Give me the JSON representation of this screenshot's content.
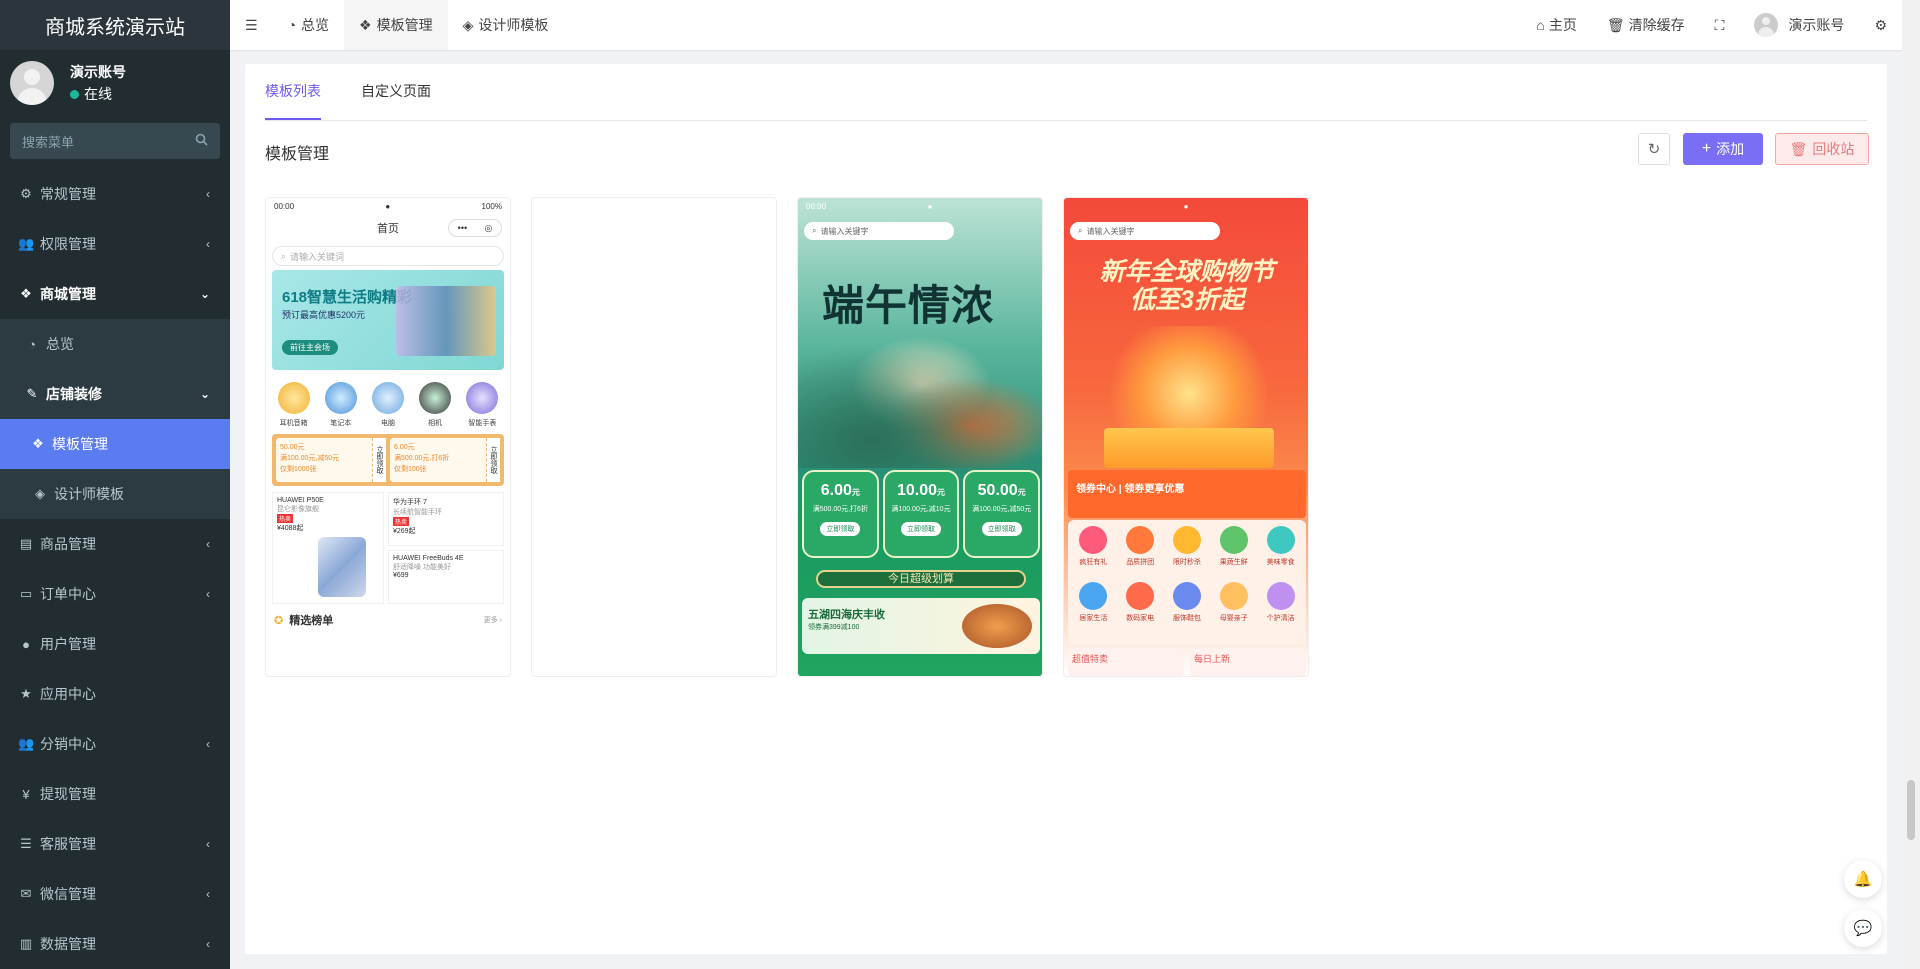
{
  "app": {
    "title": "商城系统演示站"
  },
  "user": {
    "name": "演示账号",
    "status": "在线"
  },
  "sidebar": {
    "search_placeholder": "搜索菜单",
    "items": [
      {
        "label": "常规管理"
      },
      {
        "label": "权限管理"
      },
      {
        "label": "商城管理"
      },
      {
        "label": "总览"
      },
      {
        "label": "店铺装修"
      },
      {
        "label": "模板管理"
      },
      {
        "label": "设计师模板"
      },
      {
        "label": "商品管理"
      },
      {
        "label": "订单中心"
      },
      {
        "label": "用户管理"
      },
      {
        "label": "应用中心"
      },
      {
        "label": "分销中心"
      },
      {
        "label": "提现管理"
      },
      {
        "label": "客服管理"
      },
      {
        "label": "微信管理"
      },
      {
        "label": "数据管理"
      }
    ]
  },
  "topbar": {
    "tabs": [
      {
        "label": "总览"
      },
      {
        "label": "模板管理"
      },
      {
        "label": "设计师模板"
      }
    ],
    "home": "主页",
    "clear_cache": "清除缓存",
    "account": "演示账号"
  },
  "content": {
    "tabs": [
      {
        "label": "模板列表"
      },
      {
        "label": "自定义页面"
      }
    ],
    "title": "模板管理",
    "add_label": "添加",
    "recycle_label": "回收站"
  },
  "templates": {
    "t1": {
      "time": "00:00",
      "battery": "100%",
      "page_title": "首页",
      "search": "请输入关键词",
      "banner_title": "618智慧生活购精彩",
      "banner_sub": "预订最高优惠5200元",
      "banner_btn": "前往主会场",
      "cats": [
        "耳机音箱",
        "笔记本",
        "电脑",
        "相机",
        "智能手表"
      ],
      "coupon1": {
        "price": "50.00元",
        "desc": "满100.00元,减50元",
        "limit": "仅剩1000张",
        "btn": "立即领取"
      },
      "coupon2": {
        "price": "6.00元",
        "desc": "满500.00元,打6折",
        "limit": "仅剩100张",
        "btn": "立即领取"
      },
      "p1": {
        "name": "HUAWEI P50E",
        "sub": "昆仑影像旗舰",
        "tag": "热卖",
        "price": "¥4088起"
      },
      "p2": {
        "name": "华为手环 7",
        "sub": "长续航智能手环",
        "tag": "热卖",
        "price": "¥269起"
      },
      "p3": {
        "name": "HUAWEI FreeBuds 4E",
        "sub": "舒适降噪 功能美好",
        "price": "¥699"
      },
      "rank": "精选榜单",
      "more": "更多 ›"
    },
    "t3": {
      "time": "00:00",
      "search": "请输入关键字",
      "title": "端午情浓",
      "coupons": [
        {
          "value": "6.00",
          "unit": "元",
          "desc": "满500.00元,打6折",
          "btn": "立即领取"
        },
        {
          "value": "10.00",
          "unit": "元",
          "desc": "满100.00元,减10元",
          "btn": "立即领取"
        },
        {
          "value": "50.00",
          "unit": "元",
          "desc": "满100.00元,减50元",
          "btn": "立即领取"
        }
      ],
      "bar": "今日超级划算",
      "promo_title": "五湖四海庆丰收",
      "promo_sub": "领券满399减100"
    },
    "t4": {
      "search": "请输入关键字",
      "title_line1": "新年全球购物节",
      "title_line2": "低至3折起",
      "ribbon": "领券中心 | 领券更享优惠",
      "cells": [
        "疯狂有礼",
        "品质拼团",
        "限时秒杀",
        "果蔬生鲜",
        "美味零食",
        "居家生活",
        "数码家电",
        "服饰鞋包",
        "母婴亲子",
        "个护清洁"
      ],
      "bottom": [
        "超值特卖",
        "每日上新"
      ]
    }
  },
  "colors": {
    "accent": "#7a6ef5",
    "sidebar_bg": "#222d32",
    "active_menu": "#5b7bf0"
  }
}
